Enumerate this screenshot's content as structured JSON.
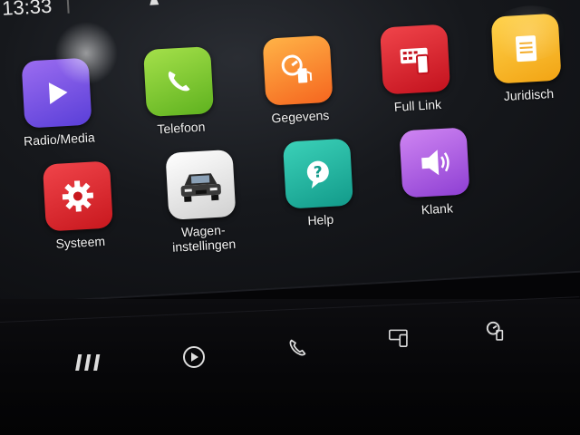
{
  "status": {
    "time": "13:33",
    "icon": "person-sound-icon"
  },
  "apps": [
    {
      "id": "radio-media",
      "label": "Radio/Media",
      "icon": "play-icon",
      "color_top": "#9b6cf0",
      "color_bottom": "#5a3fd8"
    },
    {
      "id": "telefoon",
      "label": "Telefoon",
      "icon": "phone-icon",
      "color_top": "#a4e04a",
      "color_bottom": "#5fb21f"
    },
    {
      "id": "gegevens",
      "label": "Gegevens",
      "icon": "fuel-gauge-icon",
      "color_top": "#ffb347",
      "color_bottom": "#f5661f"
    },
    {
      "id": "full-link",
      "label": "Full Link",
      "icon": "smartphone-link-icon",
      "color_top": "#f0444a",
      "color_bottom": "#c3121e"
    },
    {
      "id": "juridisch",
      "label": "Juridisch",
      "icon": "document-icon",
      "color_top": "#ffd24a",
      "color_bottom": "#f2a414"
    },
    {
      "id": "systeem",
      "label": "Systeem",
      "icon": "gear-icon",
      "color_top": "#f0444a",
      "color_bottom": "#c8181e"
    },
    {
      "id": "wagen",
      "label": "Wagen-\ninstellingen",
      "icon": "car-icon",
      "color_top": "#ffffff",
      "color_bottom": "#d0d0d0"
    },
    {
      "id": "help",
      "label": "Help",
      "icon": "question-icon",
      "color_top": "#3bd1b8",
      "color_bottom": "#129a8a"
    },
    {
      "id": "klank",
      "label": "Klank",
      "icon": "speaker-icon",
      "color_top": "#cf85f2",
      "color_bottom": "#8e3fd3"
    }
  ],
  "hardware_buttons": [
    {
      "id": "menu",
      "icon": "menu-bars-icon"
    },
    {
      "id": "media",
      "icon": "play-circle-icon"
    },
    {
      "id": "phone",
      "icon": "phone-icon"
    },
    {
      "id": "full-link",
      "icon": "smartphone-link-icon"
    },
    {
      "id": "gegevens",
      "icon": "fuel-gauge-icon"
    }
  ]
}
